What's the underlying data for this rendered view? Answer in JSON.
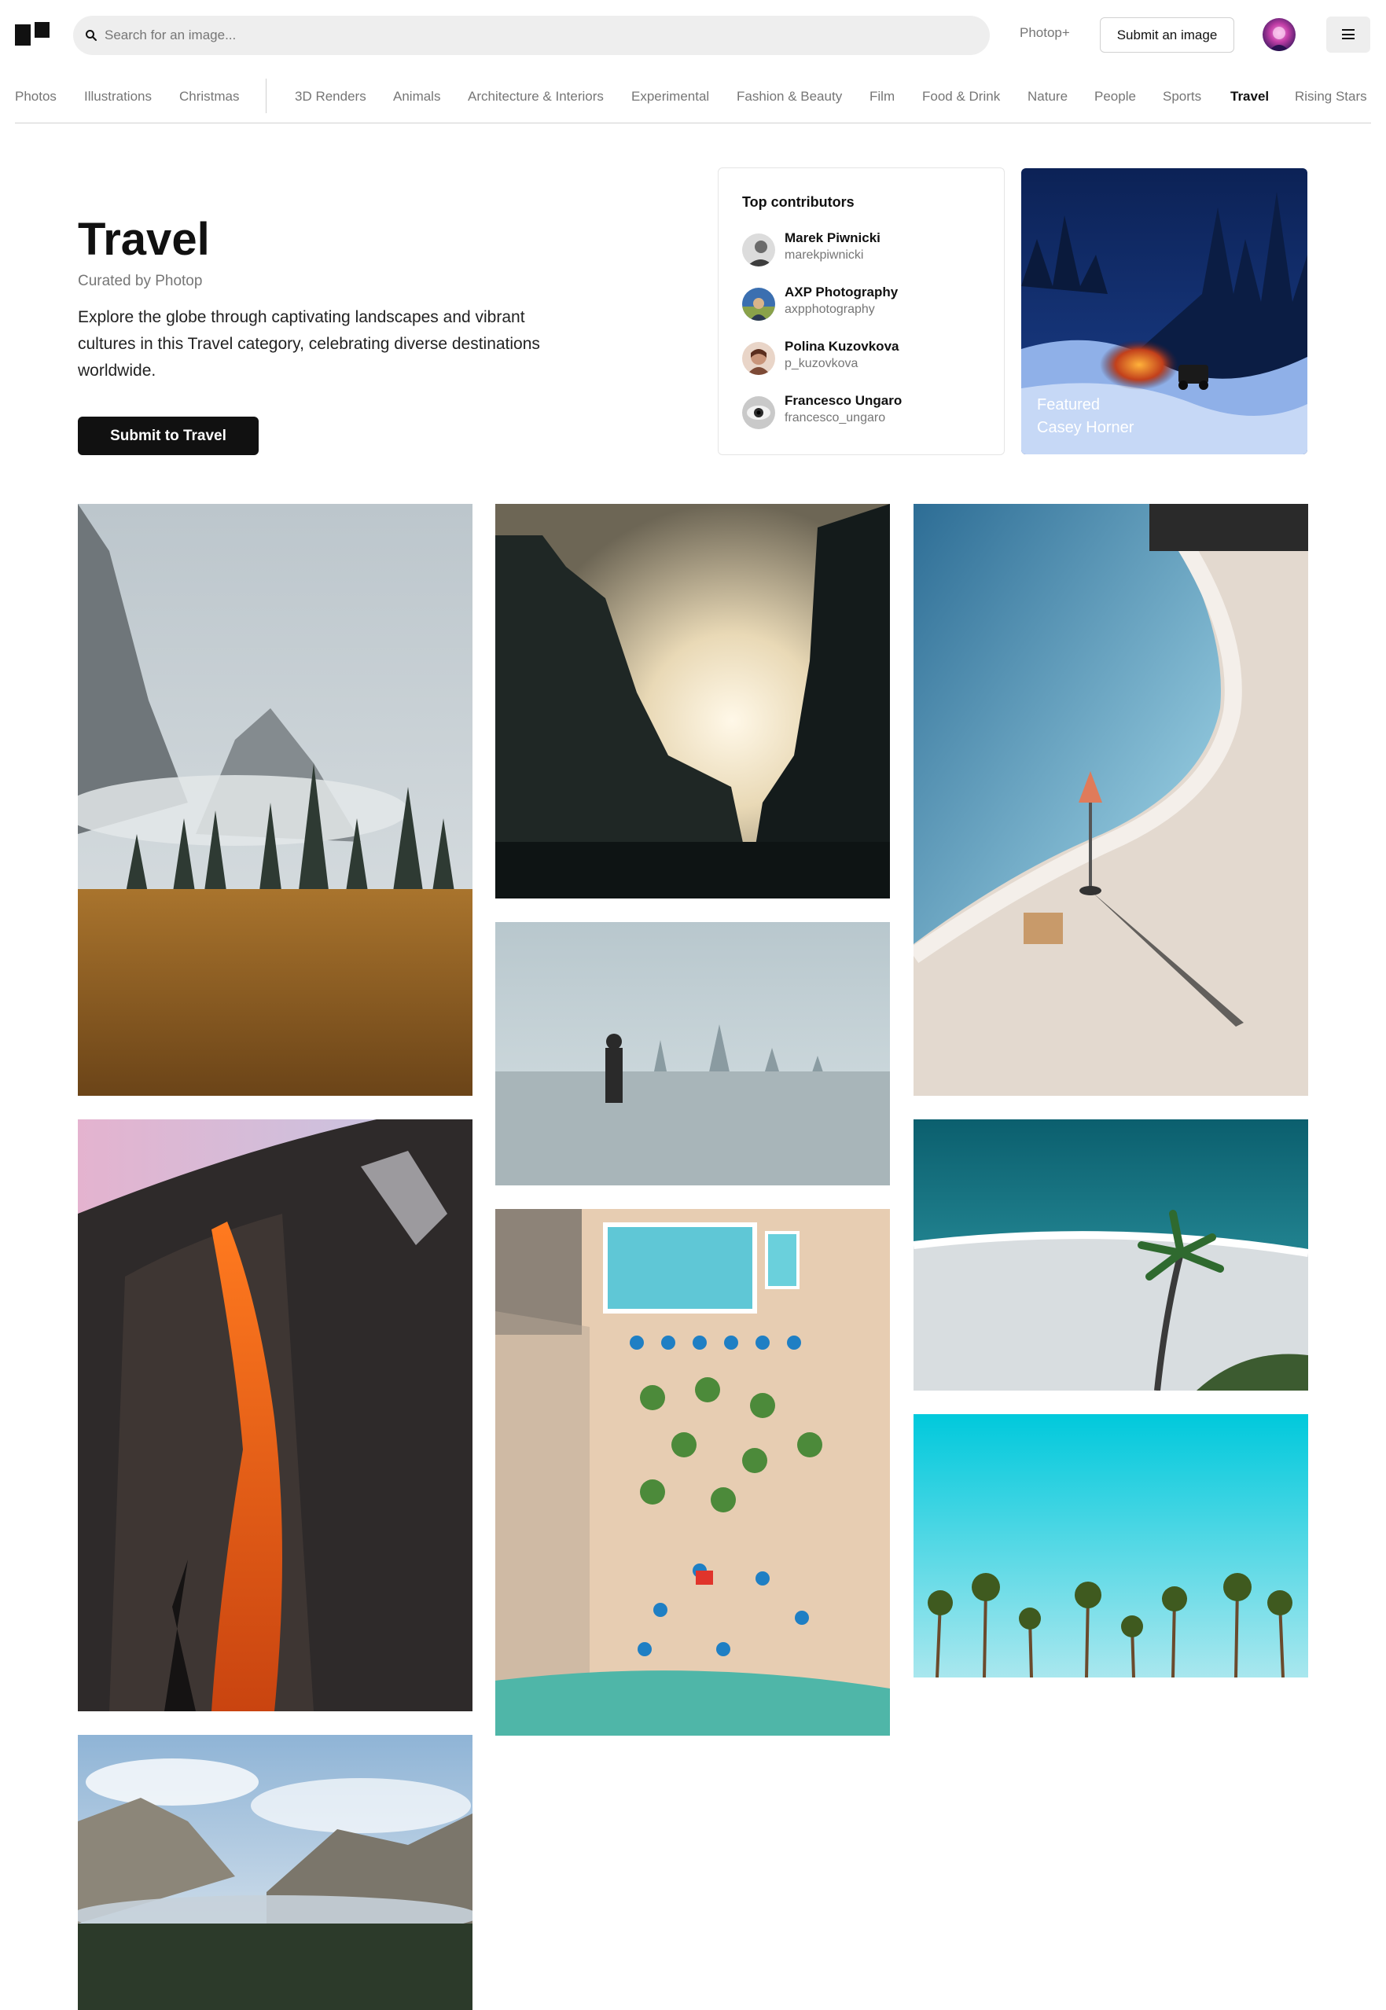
{
  "header": {
    "search_placeholder": "Search for an image...",
    "plus_link": "Photop+",
    "submit_label": "Submit an image"
  },
  "nav": {
    "primary": [
      "Photos",
      "Illustrations",
      "Christmas"
    ],
    "topics": [
      "3D Renders",
      "Animals",
      "Architecture & Interiors",
      "Experimental",
      "Fashion & Beauty",
      "Film",
      "Food & Drink",
      "Nature",
      "People",
      "Sports",
      "Travel",
      "Rising Stars"
    ],
    "active": "Travel"
  },
  "hero": {
    "title": "Travel",
    "curated": "Curated by Photop",
    "description": "Explore the globe through captivating landscapes and vibrant cultures in this Travel category, celebrating diverse destinations worldwide.",
    "cta": "Submit to Travel"
  },
  "contributors": {
    "heading": "Top contributors",
    "list": [
      {
        "name": "Marek Piwnicki",
        "handle": "marekpiwnicki"
      },
      {
        "name": "AXP Photography",
        "handle": "axpphotography"
      },
      {
        "name": "Polina Kuzovkova",
        "handle": "p_kuzovkova"
      },
      {
        "name": "Francesco Ungaro",
        "handle": "francesco_ungaro"
      }
    ]
  },
  "featured": {
    "label": "Featured",
    "author": "Casey Horner"
  },
  "colors": {
    "accent": "#111111",
    "muted_text": "#767676",
    "search_bg": "#eeeeee",
    "border": "#d1d1d1"
  },
  "icons": {
    "search": "search-icon",
    "menu": "menu-icon"
  }
}
